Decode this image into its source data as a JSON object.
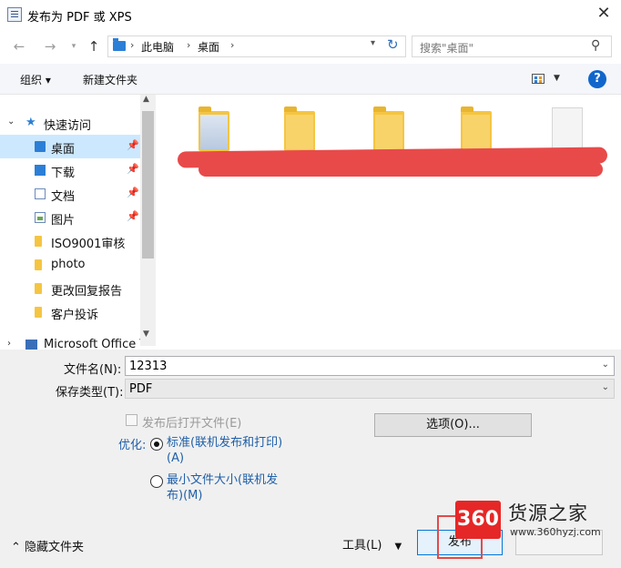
{
  "window": {
    "title": "发布为 PDF 或 XPS",
    "close": "✕"
  },
  "address": {
    "path": [
      "此电脑",
      "桌面"
    ],
    "search_placeholder": "搜索\"桌面\""
  },
  "toolbar": {
    "organize": "组织 ▾",
    "new_folder": "新建文件夹",
    "help": "?"
  },
  "nav": {
    "items": [
      {
        "label": "快速访问",
        "icon": "star-icon",
        "type": "header"
      },
      {
        "label": "桌面",
        "icon": "desktop-folder-icon",
        "pinned": true,
        "selected": true
      },
      {
        "label": "下载",
        "icon": "download-icon",
        "pinned": true
      },
      {
        "label": "文档",
        "icon": "document-icon",
        "pinned": true
      },
      {
        "label": "图片",
        "icon": "picture-icon",
        "pinned": true
      },
      {
        "label": "ISO9001审核",
        "icon": "folder-icon"
      },
      {
        "label": "photo",
        "icon": "folder-icon"
      },
      {
        "label": "更改回复报告",
        "icon": "folder-icon"
      },
      {
        "label": "客户投诉",
        "icon": "folder-icon"
      },
      {
        "label": "Microsoft Office \\",
        "icon": "office-icon"
      }
    ]
  },
  "form": {
    "filename_label": "文件名(N):",
    "filename_value": "12313",
    "filetype_label": "保存类型(T):",
    "filetype_value": "PDF",
    "open_after_label": "发布后打开文件(E)",
    "options_button": "选项(O)...",
    "optimize_label": "优化:",
    "radio_standard_1": "标准(联机发布和打印)",
    "radio_standard_2": "(A)",
    "radio_min_1": "最小文件大小(联机发",
    "radio_min_2": "布)(M)"
  },
  "footer": {
    "hide_folders": "隐藏文件夹",
    "tools": "工具(L)",
    "publish": "发布"
  },
  "watermark": {
    "badge": "360",
    "name": "货源之家",
    "url": "www.360hyzj.com"
  },
  "colors": {
    "accent": "#0078d7",
    "selection": "#cce8ff",
    "link": "#1f5fa8",
    "redaction": "#e84a4a"
  }
}
